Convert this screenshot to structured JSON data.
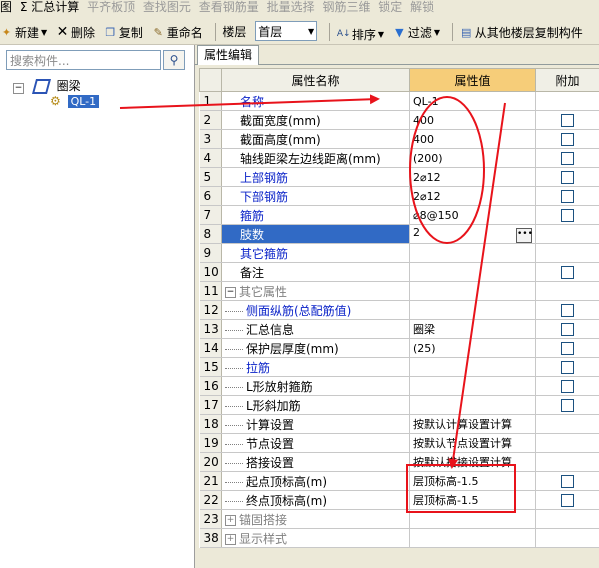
{
  "toolbar1": {
    "items": [
      {
        "label": "图"
      },
      {
        "label": "Σ 汇总计算"
      },
      {
        "label": "平齐板顶"
      },
      {
        "label": "查找图元"
      },
      {
        "label": "查看钢筋量"
      },
      {
        "label": "批量选择"
      },
      {
        "label": "钢筋三维"
      },
      {
        "label": "锁定"
      },
      {
        "label": "解锁"
      }
    ]
  },
  "toolbar2": {
    "new_label": "新建",
    "delete_label": "删除",
    "copy_label": "复制",
    "rename_label": "重命名",
    "floor_label": "楼层",
    "floor_value": "首层",
    "sort_label": "排序",
    "filter_label": "过滤",
    "copy_from_floor_label": "从其他楼层复制构件"
  },
  "left_pane": {
    "search_placeholder": "搜索构件...",
    "tree": {
      "root_expander": "−",
      "root_label": "圈梁",
      "child_label": "QL-1"
    }
  },
  "right_pane": {
    "tab_label": "属性编辑",
    "columns": {
      "name": "属性名称",
      "value": "属性值",
      "extra": "附加"
    },
    "rows": [
      {
        "num": "1",
        "name": "名称",
        "value": "QL-1",
        "blue": true,
        "check": false,
        "indent": false
      },
      {
        "num": "2",
        "name": "截面宽度(mm)",
        "value": "400",
        "blue": false,
        "check": true,
        "indent": false
      },
      {
        "num": "3",
        "name": "截面高度(mm)",
        "value": "400",
        "blue": false,
        "check": true,
        "indent": false
      },
      {
        "num": "4",
        "name": "轴线距梁左边线距离(mm)",
        "value": "(200)",
        "blue": false,
        "check": true,
        "indent": false
      },
      {
        "num": "5",
        "name": "上部钢筋",
        "value": "2⌀12",
        "blue": true,
        "check": true,
        "indent": false
      },
      {
        "num": "6",
        "name": "下部钢筋",
        "value": "2⌀12",
        "blue": true,
        "check": true,
        "indent": false
      },
      {
        "num": "7",
        "name": "箍筋",
        "value": "⌀8@150",
        "blue": true,
        "check": true,
        "indent": false
      },
      {
        "num": "8",
        "name": "肢数",
        "value": "2",
        "blue": true,
        "check": false,
        "indent": false,
        "selected": true
      },
      {
        "num": "9",
        "name": "其它箍筋",
        "value": "",
        "blue": true,
        "check": false,
        "indent": false
      },
      {
        "num": "10",
        "name": "备注",
        "value": "",
        "blue": false,
        "check": true,
        "indent": false
      },
      {
        "num": "11",
        "name": "其它属性",
        "value": "",
        "blue": false,
        "check": false,
        "indent": false,
        "group": "−"
      },
      {
        "num": "12",
        "name": "侧面纵筋(总配筋值)",
        "value": "",
        "blue": true,
        "check": true,
        "indent": true
      },
      {
        "num": "13",
        "name": "汇总信息",
        "value": "圈梁",
        "blue": false,
        "check": true,
        "indent": true
      },
      {
        "num": "14",
        "name": "保护层厚度(mm)",
        "value": "(25)",
        "blue": false,
        "check": true,
        "indent": true
      },
      {
        "num": "15",
        "name": "拉筋",
        "value": "",
        "blue": true,
        "check": true,
        "indent": true
      },
      {
        "num": "16",
        "name": "L形放射箍筋",
        "value": "",
        "blue": false,
        "check": true,
        "indent": true
      },
      {
        "num": "17",
        "name": "L形斜加筋",
        "value": "",
        "blue": false,
        "check": true,
        "indent": true
      },
      {
        "num": "18",
        "name": "计算设置",
        "value": "按默认计算设置计算",
        "blue": false,
        "check": false,
        "indent": true
      },
      {
        "num": "19",
        "name": "节点设置",
        "value": "按默认节点设置计算",
        "blue": false,
        "check": false,
        "indent": true
      },
      {
        "num": "20",
        "name": "搭接设置",
        "value": "按默认搭接设置计算",
        "blue": false,
        "check": false,
        "indent": true
      },
      {
        "num": "21",
        "name": "起点顶标高(m)",
        "value": "层顶标高-1.5",
        "blue": false,
        "check": true,
        "indent": true
      },
      {
        "num": "22",
        "name": "终点顶标高(m)",
        "value": "层顶标高-1.5",
        "blue": false,
        "check": true,
        "indent": true
      },
      {
        "num": "23",
        "name": "锚固搭接",
        "value": "",
        "blue": false,
        "check": false,
        "indent": false,
        "group": "+"
      },
      {
        "num": "38",
        "name": "显示样式",
        "value": "",
        "blue": false,
        "check": false,
        "indent": false,
        "group": "+"
      }
    ]
  },
  "annotations": {
    "color": "#e8131b"
  }
}
